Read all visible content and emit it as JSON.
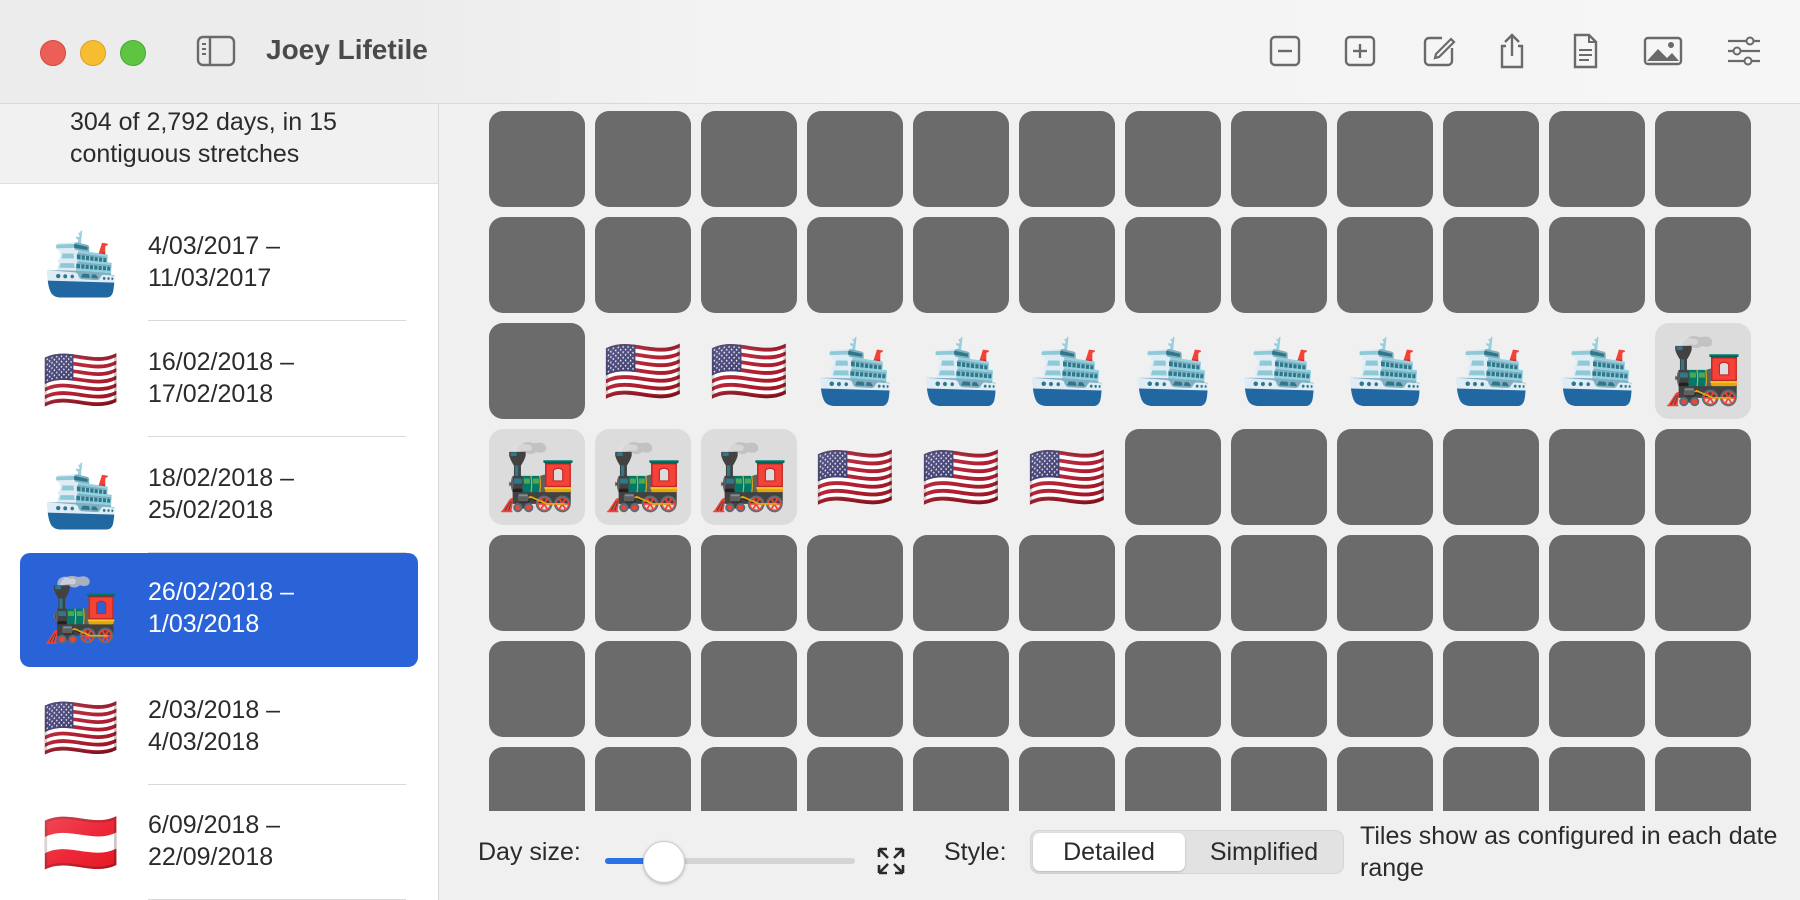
{
  "window": {
    "title": "Joey Lifetile"
  },
  "toolbar": {
    "buttons": [
      {
        "name": "zoom-out-button",
        "icon": "minus-square-icon"
      },
      {
        "name": "zoom-in-button",
        "icon": "plus-square-icon"
      },
      {
        "name": "edit-button",
        "icon": "compose-icon"
      },
      {
        "name": "share-button",
        "icon": "share-icon"
      },
      {
        "name": "document-button",
        "icon": "document-icon"
      },
      {
        "name": "image-button",
        "icon": "photo-icon"
      },
      {
        "name": "settings-button",
        "icon": "sliders-icon"
      }
    ]
  },
  "sidebar": {
    "summary": "304 of 2,792 days, in 15 contiguous stretches",
    "items": [
      {
        "emoji": "🛳️",
        "icon": "cruise-ship-icon",
        "range": "4/03/2017 – 11/03/2017",
        "selected": false
      },
      {
        "emoji": "🇺🇸",
        "icon": "us-flag-icon",
        "range": "16/02/2018 – 17/02/2018",
        "selected": false
      },
      {
        "emoji": "🛳️",
        "icon": "cruise-ship-icon",
        "range": "18/02/2018 – 25/02/2018",
        "selected": false
      },
      {
        "emoji": "🚂",
        "icon": "locomotive-icon",
        "range": "26/02/2018 – 1/03/2018",
        "selected": true
      },
      {
        "emoji": "🇺🇸",
        "icon": "us-flag-icon",
        "range": "2/03/2018 – 4/03/2018",
        "selected": false
      },
      {
        "emoji": "🇦🇹",
        "icon": "austria-flag-icon",
        "range": "6/09/2018 – 22/09/2018",
        "selected": false
      }
    ]
  },
  "grid": {
    "columns": 12,
    "rows": [
      [
        "",
        "",
        "",
        "",
        "",
        "",
        "",
        "",
        "",
        "",
        "",
        ""
      ],
      [
        "",
        "",
        "",
        "",
        "",
        "",
        "",
        "",
        "",
        "",
        "",
        ""
      ],
      [
        "",
        "🇺🇸",
        "🇺🇸",
        "🛳️",
        "🛳️",
        "🛳️",
        "🛳️",
        "🛳️",
        "🛳️",
        "🛳️",
        "🛳️",
        "🚂"
      ],
      [
        "🚂",
        "🚂",
        "🚂",
        "🇺🇸",
        "🇺🇸",
        "🇺🇸",
        "",
        "",
        "",
        "",
        "",
        ""
      ],
      [
        "",
        "",
        "",
        "",
        "",
        "",
        "",
        "",
        "",
        "",
        "",
        ""
      ],
      [
        "",
        "",
        "",
        "",
        "",
        "",
        "",
        "",
        "",
        "",
        "",
        ""
      ],
      [
        "",
        "",
        "",
        "",
        "",
        "",
        "",
        "",
        "",
        "",
        "",
        ""
      ]
    ]
  },
  "bottombar": {
    "day_size_label": "Day size:",
    "day_size_value": 0.23,
    "style_label": "Style:",
    "style_options": [
      "Detailed",
      "Simplified"
    ],
    "style_selected": "Detailed",
    "hint": "Tiles show as configured in each date range"
  },
  "colors": {
    "accent": "#2a63d8",
    "empty_tile": "#6b6b6b",
    "train_tile_bg": "#dcdcdc",
    "slider_fill": "#2a72e8"
  }
}
